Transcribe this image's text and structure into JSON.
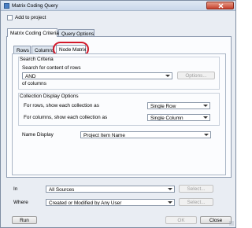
{
  "window": {
    "title": "Matrix Coding Query"
  },
  "add_to_project": {
    "label": "Add to project",
    "checked": false
  },
  "outer_tabs": [
    {
      "label": "Matrix Coding Criteria",
      "active": true
    },
    {
      "label": "Query Options",
      "active": false
    }
  ],
  "inner_tabs": [
    {
      "label": "Rows",
      "active": false
    },
    {
      "label": "Columns",
      "active": false
    },
    {
      "label": "Node Matrix",
      "active": true
    }
  ],
  "search_criteria": {
    "heading": "Search Criteria",
    "subheading": "Search for content of rows",
    "operator": "AND",
    "options_button": "Options...",
    "of_columns": "of columns"
  },
  "collection_display": {
    "heading": "Collection Display Options",
    "rows_label": "For rows, show each collection as",
    "rows_value": "Single Row",
    "columns_label": "For columns, show each collection as",
    "columns_value": "Single Column"
  },
  "name_display": {
    "label": "Name Display",
    "value": "Project Item Name"
  },
  "in_row": {
    "label": "In",
    "value": "All Sources",
    "select_button": "Select..."
  },
  "where_row": {
    "label": "Where",
    "value": "Created or Modified by Any User",
    "select_button": "Select..."
  },
  "footer": {
    "run": "Run",
    "ok": "OK",
    "close": "Close"
  },
  "colors": {
    "highlight_ring": "#d2192a",
    "title_bar": "#c9d7ea",
    "close_button": "#c6402c"
  }
}
